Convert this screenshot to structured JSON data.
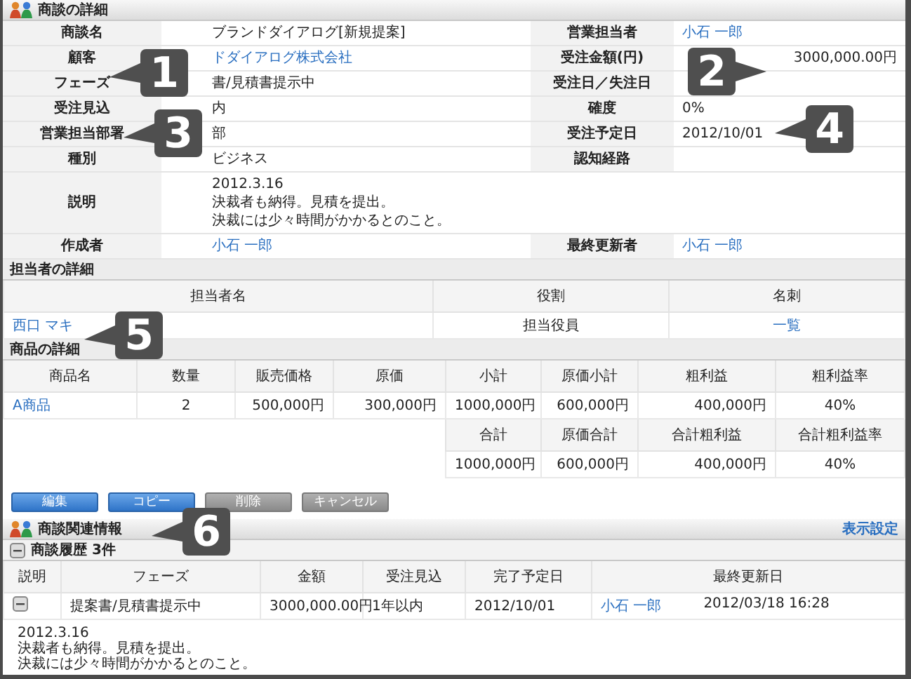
{
  "deal_details": {
    "title": "商談の詳細",
    "rows": [
      {
        "left": {
          "label": "商談名",
          "value": "ブランドダイアログ[新規提案]",
          "kind": "text"
        },
        "right": {
          "label": "営業担当者",
          "value": "小石 一郎",
          "kind": "link"
        }
      },
      {
        "left": {
          "label": "顧客",
          "value": "ドダイアログ株式会社",
          "kind": "link"
        },
        "right": {
          "label": "受注金額(円)",
          "value": "3000,000.00円",
          "kind": "amount"
        }
      },
      {
        "left": {
          "label": "フェーズ",
          "value": "書/見積書提示中",
          "kind": "text"
        },
        "right": {
          "label": "受注日／失注日",
          "kind": "text"
        }
      },
      {
        "left": {
          "label": "受注見込",
          "value": "内",
          "kind": "text"
        },
        "right": {
          "label": "確度",
          "value": "0%",
          "kind": "text"
        }
      },
      {
        "left": {
          "label": "営業担当部署",
          "value": "部",
          "kind": "text"
        },
        "right": {
          "label": "受注予定日",
          "value": "2012/10/01",
          "kind": "text"
        }
      },
      {
        "left": {
          "label": "種別",
          "value": "ビジネス",
          "kind": "text"
        },
        "right": {
          "label": "認知経路",
          "kind": "text"
        }
      },
      {
        "left": {
          "label": "説明",
          "lines": [
            "2012.3.16",
            "決裁者も納得。見積を提出。",
            "決裁には少々時間がかかるとのこと。"
          ],
          "kind": "text"
        }
      },
      {
        "left": {
          "label": "作成者",
          "value": "小石 一郎",
          "kind": "link"
        },
        "right": {
          "label": "最終更新者",
          "value": "小石 一郎",
          "kind": "link"
        }
      }
    ]
  },
  "contacts": {
    "title": "担当者の詳細",
    "columns": [
      "担当者名",
      "役割",
      "名刺"
    ],
    "rows": [
      [
        {
          "value": "西口 マキ",
          "kind": "link"
        },
        {
          "value": "担当役員",
          "kind": "text"
        },
        {
          "value": "一覧",
          "kind": "link"
        }
      ]
    ]
  },
  "products": {
    "title": "商品の詳細",
    "columns": [
      "商品名",
      "数量",
      "販売価格",
      "原価",
      "小計",
      "原価小計",
      "粗利益",
      "粗利益率"
    ],
    "rows": [
      [
        {
          "value": "A商品",
          "kind": "link"
        },
        {
          "value": "2",
          "kind": "text"
        },
        {
          "value": "500,000円",
          "kind": "amount"
        },
        {
          "value": "300,000円",
          "kind": "amount"
        },
        {
          "value": "1000,000円",
          "kind": "amount"
        },
        {
          "value": "600,000円",
          "kind": "amount"
        },
        {
          "value": "400,000円",
          "kind": "amount"
        },
        {
          "value": "40%",
          "kind": "text"
        }
      ]
    ],
    "total_columns": [
      "合計",
      "原価合計",
      "合計粗利益",
      "合計粗利益率"
    ],
    "totals": [
      "1000,000円",
      "600,000円",
      "400,000円",
      "40%"
    ]
  },
  "buttons": [
    {
      "label": "編集",
      "kind": "primary"
    },
    {
      "label": "コピー",
      "kind": "primary"
    },
    {
      "label": "削除",
      "kind": "secondary"
    },
    {
      "label": "キャンセル",
      "kind": "secondary"
    }
  ],
  "related": {
    "title": "商談関連情報",
    "link": "表示設定",
    "history": {
      "title": "商談履歴 3件",
      "expanded": true,
      "columns": [
        "説明",
        "フェーズ",
        "金額",
        "受注見込",
        "完了予定日",
        "最終更新日"
      ],
      "rows": [
        {
          "expanded": true,
          "phase": "提案書/見積書提示中",
          "amount": "3000,000.00円",
          "prospect": "1年以内",
          "due": "2012/10/01",
          "updated_by": "小石 一郎",
          "updated_at": "2012/03/18 16:28",
          "description": [
            "2012.3.16",
            "決裁者も納得。見積を提出。",
            "決裁には少々時間がかかるとのこと。"
          ]
        }
      ]
    }
  },
  "callouts": [
    {
      "number": "1",
      "kind": "left"
    },
    {
      "number": "2",
      "kind": "right"
    },
    {
      "number": "3",
      "kind": "left"
    },
    {
      "number": "4",
      "kind": "left"
    },
    {
      "number": "5",
      "kind": "left"
    },
    {
      "number": "6",
      "kind": "left"
    }
  ]
}
